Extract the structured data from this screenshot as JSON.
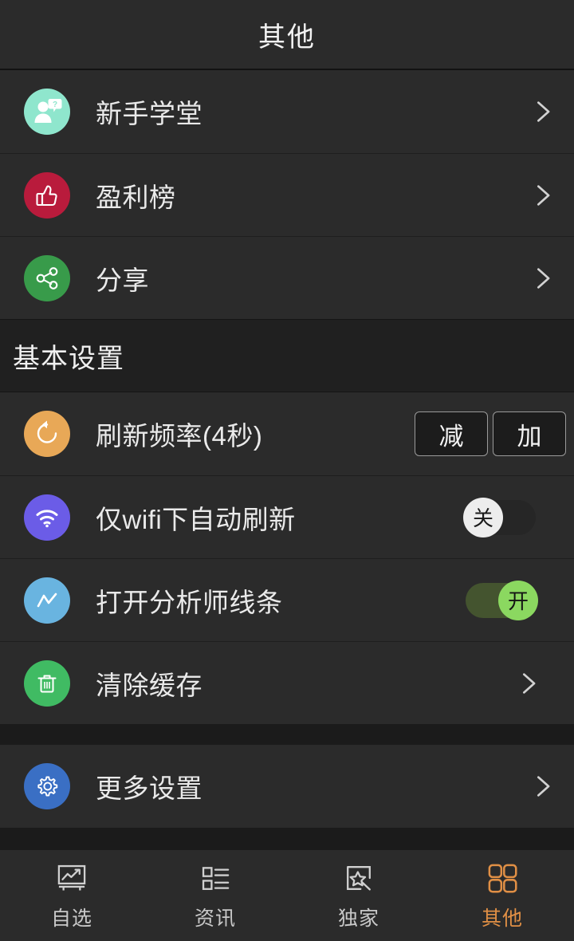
{
  "header": {
    "title": "其他"
  },
  "colors": {
    "page_bg": "#1b1b1b",
    "row_bg": "#2b2b2b",
    "section_bg": "#202020",
    "accent_orange": "#e08f45",
    "toggle_on_track": "#44542f",
    "toggle_on_knob": "#8bd860",
    "toggle_off_knob": "#ededed",
    "icon_tutorial_bg": "#8fe6cd",
    "icon_profit_bg": "#b91b3c",
    "icon_share_bg": "#389b4a",
    "icon_refresh_bg": "#e8a857",
    "icon_wifi_bg": "#6b5ce7",
    "icon_analyst_bg": "#69b4e0",
    "icon_clear_bg": "#40bb63",
    "icon_settings_bg": "#3a6fc4"
  },
  "top_section": {
    "items": [
      {
        "label": "新手学堂",
        "icon": "tutorial-person-question-icon",
        "chevron": "chevron-right-icon"
      },
      {
        "label": "盈利榜",
        "icon": "thumbs-up-icon",
        "chevron": "chevron-right-icon"
      },
      {
        "label": "分享",
        "icon": "share-nodes-icon",
        "chevron": "chevron-right-icon"
      }
    ]
  },
  "basic_settings": {
    "title": "基本设置",
    "refresh": {
      "label": "刷新频率(4秒)",
      "icon": "refresh-arrow-icon",
      "decrease_label": "减",
      "increase_label": "加"
    },
    "wifi": {
      "label": "仅wifi下自动刷新",
      "icon": "wifi-icon",
      "toggle_state": "off",
      "toggle_label": "关"
    },
    "analyst": {
      "label": "打开分析师线条",
      "icon": "analyst-line-chart-icon",
      "toggle_state": "on",
      "toggle_label": "开"
    },
    "clear_cache": {
      "label": "清除缓存",
      "icon": "trash-can-icon",
      "chevron": "chevron-right-icon"
    }
  },
  "more_section": {
    "item": {
      "label": "更多设置",
      "icon": "gear-icon",
      "chevron": "chevron-right-icon"
    }
  },
  "tabbar": {
    "tabs": [
      {
        "label": "自选",
        "icon": "chart-board-icon",
        "active": false
      },
      {
        "label": "资讯",
        "icon": "news-list-icon",
        "active": false
      },
      {
        "label": "独家",
        "icon": "star-frame-icon",
        "active": false
      },
      {
        "label": "其他",
        "icon": "grid-squares-icon",
        "active": true
      }
    ]
  }
}
